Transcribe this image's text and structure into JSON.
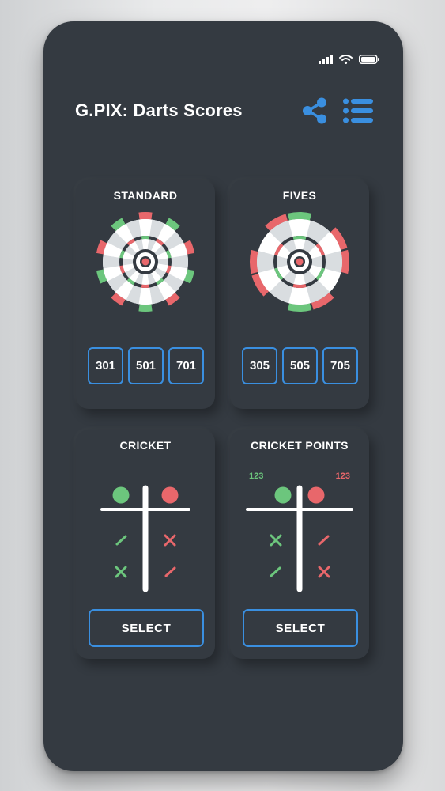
{
  "app": {
    "title": "G.PIX: Darts Scores"
  },
  "colors": {
    "accent": "#3a8fe0",
    "green": "#6cc67d",
    "red": "#e8676b",
    "panel": "#343a41"
  },
  "status_bar": {
    "icons": [
      "signal-icon",
      "wifi-icon",
      "battery-icon"
    ]
  },
  "header": {
    "actions": [
      "share-icon",
      "list-menu-icon"
    ]
  },
  "cards": {
    "standard": {
      "title": "STANDARD",
      "scores": [
        "301",
        "501",
        "701"
      ]
    },
    "fives": {
      "title": "FIVES",
      "scores": [
        "305",
        "505",
        "705"
      ]
    },
    "cricket": {
      "title": "CRICKET",
      "select_label": "SELECT"
    },
    "cricket_points": {
      "title": "CRICKET POINTS",
      "select_label": "SELECT",
      "left_points": "123",
      "right_points": "123"
    }
  }
}
